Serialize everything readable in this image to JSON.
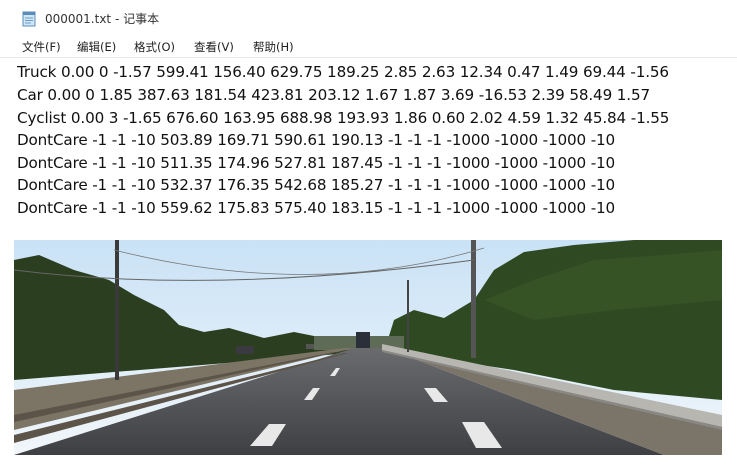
{
  "window": {
    "title": "000001.txt - 记事本",
    "icon": "notepad-icon"
  },
  "menu": [
    {
      "label": "文件(F)"
    },
    {
      "label": "编辑(E)"
    },
    {
      "label": "格式(O)"
    },
    {
      "label": "查看(V)"
    },
    {
      "label": "帮助(H)"
    }
  ],
  "document": {
    "lines": [
      "Truck 0.00 0 -1.57 599.41 156.40 629.75 189.25 2.85 2.63 12.34 0.47 1.49 69.44 -1.56",
      "Car 0.00 0 1.85 387.63 181.54 423.81 203.12 1.67 1.87 3.69 -16.53 2.39 58.49 1.57",
      "Cyclist 0.00 3 -1.65 676.60 163.95 688.98 193.93 1.86 0.60 2.02 4.59 1.32 45.84 -1.55",
      "DontCare -1 -1 -10 503.89 169.71 590.61 190.13 -1 -1 -1 -1000 -1000 -1000 -10",
      "DontCare -1 -1 -10 511.35 174.96 527.81 187.45 -1 -1 -1 -1000 -1000 -1000 -10",
      "DontCare -1 -1 -10 532.37 176.35 542.68 185.27 -1 -1 -1 -1000 -1000 -1000 -10",
      "DontCare -1 -1 -10 559.62 175.83 575.40 183.15 -1 -1 -1 -1000 -1000 -1000 -10"
    ]
  },
  "colors": {
    "background": "#ffffff",
    "text": "#111111",
    "sky": "#dfeefa",
    "foliage": "#2f4a22",
    "road": "#4f4f52"
  }
}
